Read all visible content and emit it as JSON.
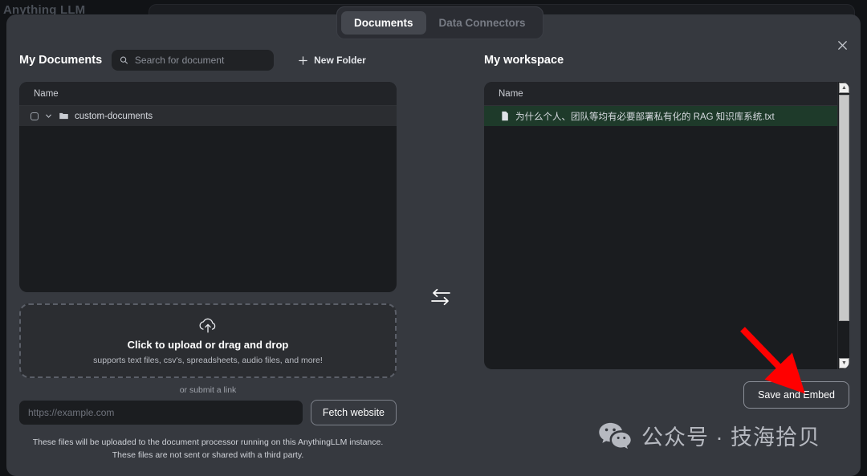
{
  "background": {
    "brand": "Anything LLM"
  },
  "modal": {
    "tabs": [
      {
        "label": "Documents",
        "active": true
      },
      {
        "label": "Data Connectors",
        "active": false
      }
    ],
    "close_label": "×"
  },
  "left_panel": {
    "title": "My Documents",
    "search_placeholder": "Search for document",
    "search_value": "",
    "new_folder_label": "New Folder",
    "list": {
      "column_header": "Name",
      "rows": [
        {
          "label": "custom-documents",
          "type": "folder",
          "checked": false,
          "expanded": true
        }
      ]
    },
    "dropzone": {
      "title": "Click to upload or drag and drop",
      "subtitle": "supports text files, csv's, spreadsheets, audio files, and more!"
    },
    "or_link": "or submit a link",
    "url_placeholder": "https://example.com",
    "url_value": "",
    "fetch_button": "Fetch website",
    "note_line1": "These files will be uploaded to the document processor running on this AnythingLLM instance.",
    "note_line2": "These files are not sent or shared with a third party."
  },
  "swap": {
    "icon": "left-right-arrows-icon"
  },
  "right_panel": {
    "title": "My workspace",
    "list": {
      "column_header": "Name",
      "rows": [
        {
          "label": "为什么个人、团队等均有必要部署私有化的 RAG 知识库系统.txt",
          "type": "file",
          "selected": true
        }
      ]
    },
    "save_button": "Save and Embed"
  },
  "watermark": {
    "text": "公众号 · 技海拾贝",
    "icon": "wechat-icon"
  },
  "colors": {
    "modal_bg": "#36393f",
    "panel_bg": "#1a1c1f",
    "selected_row": "#1e3a2a",
    "accent_annotation": "#ff0000",
    "tab_active_bg": "#44474e"
  }
}
